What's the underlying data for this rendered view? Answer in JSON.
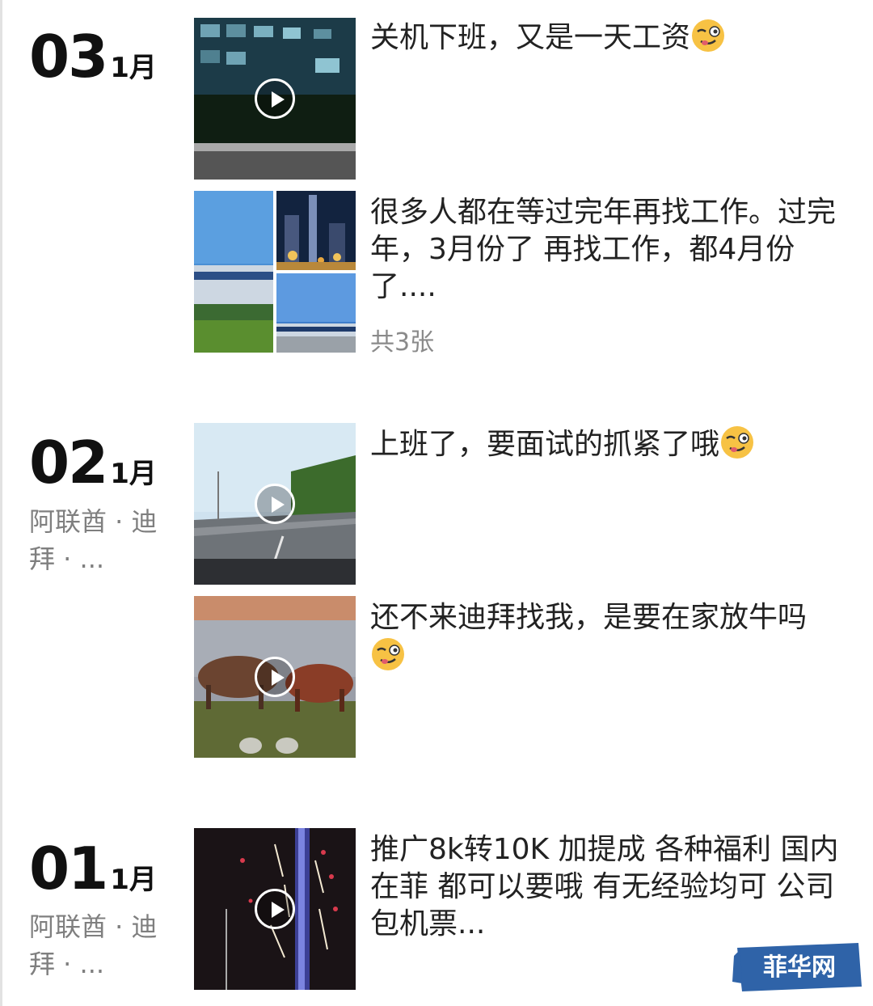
{
  "entries": [
    {
      "day": "03",
      "month": "1月",
      "posts": [
        {
          "type": "video",
          "thumb": "night-office",
          "text": "关机下班，又是一天工资",
          "emoji": "wink-tongue-icon"
        },
        {
          "type": "photos",
          "text": "很多人都在等过完年再找工作。过完年，3月份了 再找工作，都4月份了....",
          "count": "共3张"
        }
      ]
    },
    {
      "day": "02",
      "month": "1月",
      "location": "阿联酋 · 迪拜 · ...",
      "posts": [
        {
          "type": "video",
          "thumb": "road",
          "text": "上班了，要面试的抓紧了哦",
          "emoji": "wink-tongue-icon"
        },
        {
          "type": "video",
          "thumb": "cows",
          "text": "还不来迪拜找我，是要在家放牛吗",
          "emoji": "wink-tongue-icon"
        }
      ]
    },
    {
      "day": "01",
      "month": "1月",
      "location": "阿联酋 · 迪拜 · ...",
      "posts": [
        {
          "type": "video",
          "thumb": "fireworks",
          "text": "推广8k转10K 加提成 各种福利 国内 在菲 都可以要哦 有无经验均可 公司包机票..."
        }
      ]
    }
  ],
  "watermark": "菲华网"
}
